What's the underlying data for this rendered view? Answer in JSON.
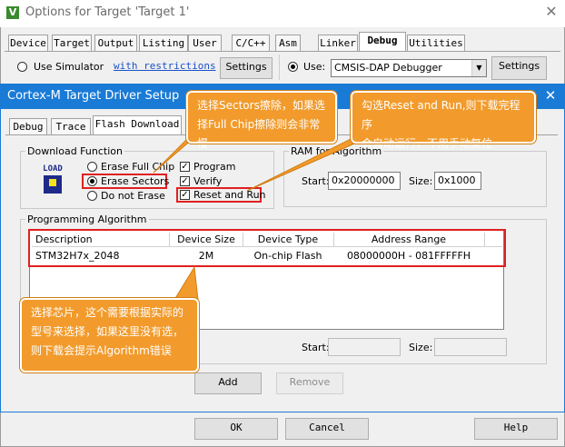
{
  "outer_window": {
    "title": "Options for Target 'Target 1'",
    "tabs": [
      "Device",
      "Target",
      "Output",
      "Listing",
      "User",
      "C/C++",
      "Asm",
      "Linker",
      "Debug",
      "Utilities"
    ],
    "use_simulator": "Use Simulator",
    "restrictions_link": "with restrictions",
    "settings_left": "Settings",
    "use_label": "Use:",
    "debugger": "CMSIS-DAP Debugger",
    "settings_right": "Settings",
    "ok": "OK",
    "cancel": "Cancel",
    "help": "Help"
  },
  "dialog": {
    "title": "Cortex-M Target Driver Setup",
    "tabs": [
      "Debug",
      "Trace",
      "Flash Download"
    ],
    "download_function": {
      "title": "Download Function",
      "load_icon_text": "LOAD",
      "erase_full_chip": "Erase Full Chip",
      "erase_sectors": "Erase Sectors",
      "do_not_erase": "Do not Erase",
      "program": "Program",
      "verify": "Verify",
      "reset_and_run": "Reset and Run"
    },
    "ram": {
      "title": "RAM for Algorithm",
      "start_label": "Start:",
      "start_value": "0x20000000",
      "size_label": "Size:",
      "size_value": "0x1000"
    },
    "programming_algorithm": {
      "title": "Programming Algorithm",
      "columns": [
        "Description",
        "Device Size",
        "Device Type",
        "Address Range"
      ],
      "row": [
        "STM32H7x_2048",
        "2M",
        "On-chip Flash",
        "08000000H - 081FFFFFH"
      ],
      "start_label": "Start:",
      "size_label": "Size:"
    },
    "add": "Add",
    "remove": "Remove"
  },
  "callouts": {
    "sectors_line1": "选择Sectors擦除，如果选",
    "sectors_line2": "择Full Chip擦除则会非常慢",
    "reset_line1": "勾选Reset and Run,则下载完程序",
    "reset_line2": "会自动运行，不用手动复位",
    "chip_line1": "选择芯片，这个需要根据实际的",
    "chip_line2": "型号来选择，如果这里没有选，",
    "chip_line3": "则下载会提示Algorithm错误"
  },
  "colors": {
    "dialog_title_bar": "#1a7bd6",
    "callout": "#f29b2c",
    "highlight": "#e02020"
  }
}
